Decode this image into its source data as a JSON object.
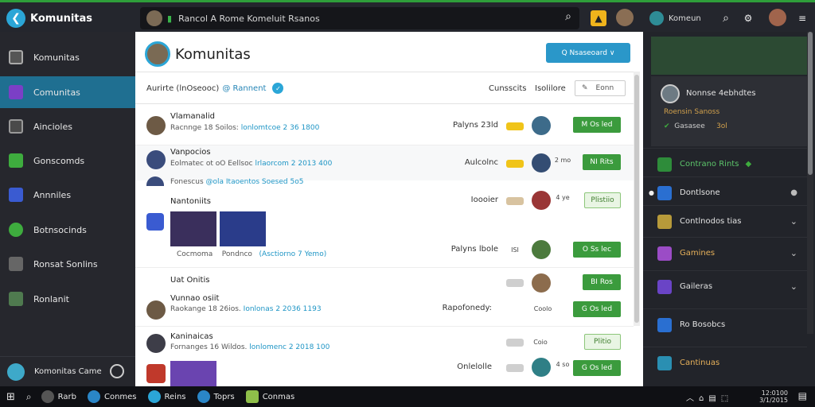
{
  "app": {
    "title": "Komunitas"
  },
  "address": {
    "text": "Rancol A Rome Komeluit Rsanos"
  },
  "top_user": {
    "name": "Komeun"
  },
  "sidebar": {
    "items": [
      {
        "label": "Komunitas",
        "icon": "home-icon",
        "active": false
      },
      {
        "label": "Comunitas",
        "icon": "people-icon",
        "active": true
      },
      {
        "label": "Aincioles",
        "icon": "star-icon",
        "active": false
      },
      {
        "label": "Gonscomds",
        "icon": "game-icon",
        "active": false
      },
      {
        "label": "Annniles",
        "icon": "grid-icon",
        "active": false
      },
      {
        "label": "Botnsocinds",
        "icon": "globe-icon",
        "active": false
      },
      {
        "label": "Ronsat Sonlins",
        "icon": "cube-icon",
        "active": false
      },
      {
        "label": "Ronlanit",
        "icon": "box-icon",
        "active": false
      }
    ],
    "footer": {
      "label": "Komonitas Came"
    }
  },
  "main": {
    "title": "Komunitas",
    "primary_button": "Q  Nsaseoard ∨",
    "filter": {
      "label": "Aurirte (lnOseooc)",
      "link": "@ Rannent",
      "badge": "✓"
    },
    "sort_labels": [
      "Cunsscits",
      "Isolilore"
    ],
    "select": {
      "value": "Eonn"
    },
    "rows": [
      {
        "name": "Vlamanalid",
        "sub_text": "Racnnge 18 Soilos:",
        "sub_link": "lonlomtcoe 2 36 1800",
        "meta": "Palyns 23ld",
        "pill_color": "#f0c419",
        "count": "",
        "button": "M Os led",
        "button_style": "solid",
        "avatar_color": "#6d5a45",
        "pav_color": "#3d6b8a"
      },
      {
        "name": "Vanpocios",
        "sub_text": "Eolmatec ot oO Eellsoc",
        "sub_link": "lrlaorcom 2 2013 400",
        "meta": "Aulcolnc",
        "pill_color": "#f0c419",
        "count": "2 mo",
        "button": "NI Rits",
        "button_style": "solid",
        "avatar_color": "#3a4c7c",
        "pav_color": "#344d73"
      },
      {
        "name": "",
        "sub_text": "Fonescus",
        "sub_link": "@ola Itaoentos Soesed 5o5",
        "meta": "Ioooier",
        "pill_color": "#d8c3a0",
        "count": "4 ye",
        "button": "Plistiio",
        "button_style": "outline",
        "avatar_color": "#3a4c7c",
        "pav_color": "#9a3636"
      },
      {
        "name": "Nantoniits",
        "sub_text": "Cocmoma",
        "sub_link": "Pondnco",
        "sub_link2": "(Asctiorno 7 Yemo)",
        "meta": "Palyns lbole",
        "pill_color": "",
        "count": "ISI",
        "button": "O Ss lec",
        "button_style": "solid",
        "avatar_color": "#3d5c9c",
        "pav_color": "#4c7a3d"
      },
      {
        "name": "Uat Onitis",
        "sub_text": "",
        "sub_link": "",
        "meta": "",
        "pill_color": "#cfcfcf",
        "count": "",
        "button": "BI Ros",
        "button_style": "solid",
        "avatar_color": "",
        "pav_color": "#8c6c4d"
      },
      {
        "name": "Vunnao osiit",
        "sub_text": "Raokange 18 26ios.",
        "sub_link": "Ionlonas 2 2036 1193",
        "meta": "Rapofonedy:",
        "pill_color": "",
        "count": "Coolo",
        "button": "G Os led",
        "button_style": "solid",
        "avatar_color": "#6d5a45",
        "pav_color": "#c65a2f"
      },
      {
        "name": "Kaninaicas",
        "sub_text": "Fornanges 16 Wildos.",
        "sub_link": "lonlomenc 2 2018 100",
        "meta": "",
        "pill_color": "#cfcfcf",
        "count": "Coio",
        "button": "Plitio",
        "button_style": "outline",
        "avatar_color": "#3d3d48",
        "pav_color": "#546bd1"
      },
      {
        "name": "",
        "sub_text": "",
        "sub_link": "",
        "meta": "Onlelolle",
        "pill_color": "#cfcfcf",
        "count": "4 so",
        "button": "G Os led",
        "button_style": "solid",
        "avatar_color": "#c0392b",
        "pav_color": "#2f7f86"
      }
    ]
  },
  "right_panel": {
    "profile": {
      "name": "Nonnse 4ebhdtes",
      "line2": "Roensin Sanoss",
      "line3": "Gasasee",
      "stat": "3ol"
    },
    "items": [
      {
        "label": "Contrano Rints",
        "color": "#2e8c3a",
        "chevron": false
      },
      {
        "label": "Dontlsone",
        "color": "#2a6fd1",
        "chevron": false
      },
      {
        "label": "Contlnodos tias",
        "color": "#b79a3a",
        "chevron": true
      },
      {
        "label": "Gamines",
        "color": "#9b4cc6",
        "chevron": true
      },
      {
        "label": "Gaileras",
        "color": "#6a44c6",
        "chevron": true
      },
      {
        "label": "Ro Bosobcs",
        "color": "#2a6fd1",
        "chevron": false
      },
      {
        "label": "Cantinuas",
        "color": "#2a8fb2",
        "chevron": false
      }
    ]
  },
  "taskbar": {
    "items": [
      {
        "label": "Rarb",
        "color": "#555"
      },
      {
        "label": "Conmes",
        "color": "#2a86c7"
      },
      {
        "label": "Reins",
        "color": "#2ba6d7"
      },
      {
        "label": "Toprs",
        "color": "#2a86c7"
      },
      {
        "label": "Conmas",
        "color": "#8fbf4a"
      }
    ],
    "time": "12:0100",
    "date": "3/1/2015"
  },
  "colors": {
    "accent": "#2ba6d7",
    "green": "#3b9b3d",
    "sidebar_active": "#1f6f91"
  }
}
